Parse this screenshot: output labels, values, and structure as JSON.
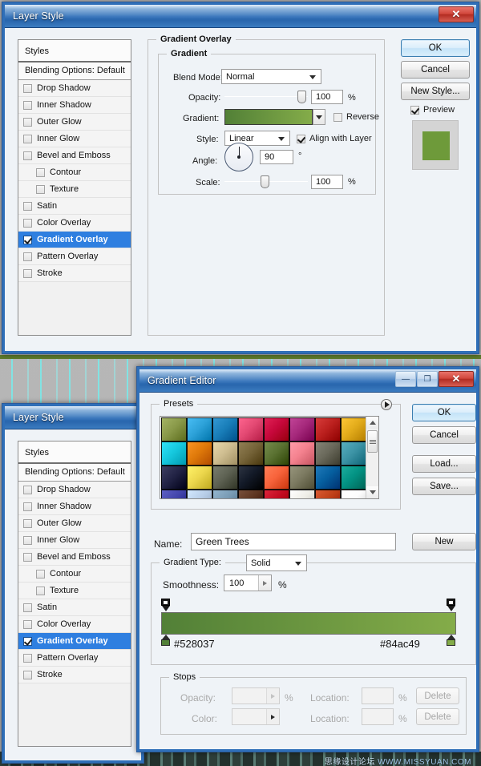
{
  "desktop": {
    "watermark_cn": "思缘设计论坛",
    "watermark_url": "WWW.MISSYUAN.COM"
  },
  "layer_style_top": {
    "title": "Layer Style",
    "close_label": "✕",
    "styles_panel": {
      "header": "Styles",
      "blending_options": "Blending Options: Default",
      "items": [
        {
          "label": "Drop Shadow",
          "checked": false,
          "indent": false,
          "selected": false
        },
        {
          "label": "Inner Shadow",
          "checked": false,
          "indent": false,
          "selected": false
        },
        {
          "label": "Outer Glow",
          "checked": false,
          "indent": false,
          "selected": false
        },
        {
          "label": "Inner Glow",
          "checked": false,
          "indent": false,
          "selected": false
        },
        {
          "label": "Bevel and Emboss",
          "checked": false,
          "indent": false,
          "selected": false
        },
        {
          "label": "Contour",
          "checked": false,
          "indent": true,
          "selected": false
        },
        {
          "label": "Texture",
          "checked": false,
          "indent": true,
          "selected": false
        },
        {
          "label": "Satin",
          "checked": false,
          "indent": false,
          "selected": false
        },
        {
          "label": "Color Overlay",
          "checked": false,
          "indent": false,
          "selected": false
        },
        {
          "label": "Gradient Overlay",
          "checked": true,
          "indent": false,
          "selected": true
        },
        {
          "label": "Pattern Overlay",
          "checked": false,
          "indent": false,
          "selected": false
        },
        {
          "label": "Stroke",
          "checked": false,
          "indent": false,
          "selected": false
        }
      ]
    },
    "panel": {
      "section_title": "Gradient Overlay",
      "group_title": "Gradient",
      "blend_mode_label": "Blend Mode:",
      "blend_mode_value": "Normal",
      "opacity_label": "Opacity:",
      "opacity_value": "100",
      "opacity_unit": "%",
      "gradient_label": "Gradient:",
      "reverse_label": "Reverse",
      "reverse_checked": false,
      "style_label": "Style:",
      "style_value": "Linear",
      "align_label": "Align with Layer",
      "align_checked": true,
      "angle_label": "Angle:",
      "angle_value": "90",
      "angle_unit": "°",
      "scale_label": "Scale:",
      "scale_value": "100",
      "scale_unit": "%",
      "gradient_start": "#528037",
      "gradient_end": "#84ac49"
    },
    "buttons": {
      "ok": "OK",
      "cancel": "Cancel",
      "new_style": "New Style...",
      "preview_label": "Preview",
      "preview_checked": true,
      "preview_color": "#6e9a3a"
    }
  },
  "layer_style_bottom": {
    "title": "Layer Style",
    "styles_panel": {
      "header": "Styles",
      "blending_options": "Blending Options: Default",
      "items": [
        {
          "label": "Drop Shadow",
          "checked": false,
          "indent": false,
          "selected": false
        },
        {
          "label": "Inner Shadow",
          "checked": false,
          "indent": false,
          "selected": false
        },
        {
          "label": "Outer Glow",
          "checked": false,
          "indent": false,
          "selected": false
        },
        {
          "label": "Inner Glow",
          "checked": false,
          "indent": false,
          "selected": false
        },
        {
          "label": "Bevel and Emboss",
          "checked": false,
          "indent": false,
          "selected": false
        },
        {
          "label": "Contour",
          "checked": false,
          "indent": true,
          "selected": false
        },
        {
          "label": "Texture",
          "checked": false,
          "indent": true,
          "selected": false
        },
        {
          "label": "Satin",
          "checked": false,
          "indent": false,
          "selected": false
        },
        {
          "label": "Color Overlay",
          "checked": false,
          "indent": false,
          "selected": false
        },
        {
          "label": "Gradient Overlay",
          "checked": true,
          "indent": false,
          "selected": true
        },
        {
          "label": "Pattern Overlay",
          "checked": false,
          "indent": false,
          "selected": false
        },
        {
          "label": "Stroke",
          "checked": false,
          "indent": false,
          "selected": false
        }
      ]
    }
  },
  "gradient_editor": {
    "title": "Gradient Editor",
    "min_label": "—",
    "max_label": "❐",
    "close_label": "✕",
    "presets_title": "Presets",
    "presets": [
      [
        "#8a9a4a",
        "#2ea3da",
        "#1a7fba",
        "#e44a74",
        "#c7083c",
        "#a72a7d",
        "#bd2220",
        "#e4ad1c"
      ],
      [
        "#16c8de",
        "#e07a0a",
        "#cfbe91",
        "#77653a",
        "#5b7232",
        "#f4828f",
        "#6b6a5c",
        "#3d94a6"
      ],
      [
        "#232446",
        "#edd84e",
        "#5f6354",
        "#131a28",
        "#f8643c",
        "#7d7b62",
        "#0660a0",
        "#039384"
      ],
      [
        "#4345ab",
        "#b8cee8",
        "#7a9cb5",
        "#5d3520",
        "#c20a20",
        "#efeee7",
        "#bf4018",
        "#fdfdfd"
      ]
    ],
    "name_label": "Name:",
    "name_value": "Green Trees",
    "new_button": "New",
    "gradient_type_label": "Gradient Type:",
    "gradient_type_value": "Solid",
    "smoothness_label": "Smoothness:",
    "smoothness_value": "100",
    "smoothness_unit": "%",
    "gradient_start": "#528037",
    "gradient_end": "#84ac49",
    "start_hex_label": "#528037",
    "end_hex_label": "#84ac49",
    "stops_title": "Stops",
    "opacity_label": "Opacity:",
    "opacity_value": "",
    "opacity_unit": "%",
    "opacity_location_label": "Location:",
    "opacity_location_value": "",
    "opacity_location_unit": "%",
    "opacity_delete": "Delete",
    "color_label": "Color:",
    "color_location_label": "Location:",
    "color_location_value": "",
    "color_location_unit": "%",
    "color_delete": "Delete",
    "buttons": {
      "ok": "OK",
      "cancel": "Cancel",
      "load": "Load...",
      "save": "Save..."
    }
  }
}
